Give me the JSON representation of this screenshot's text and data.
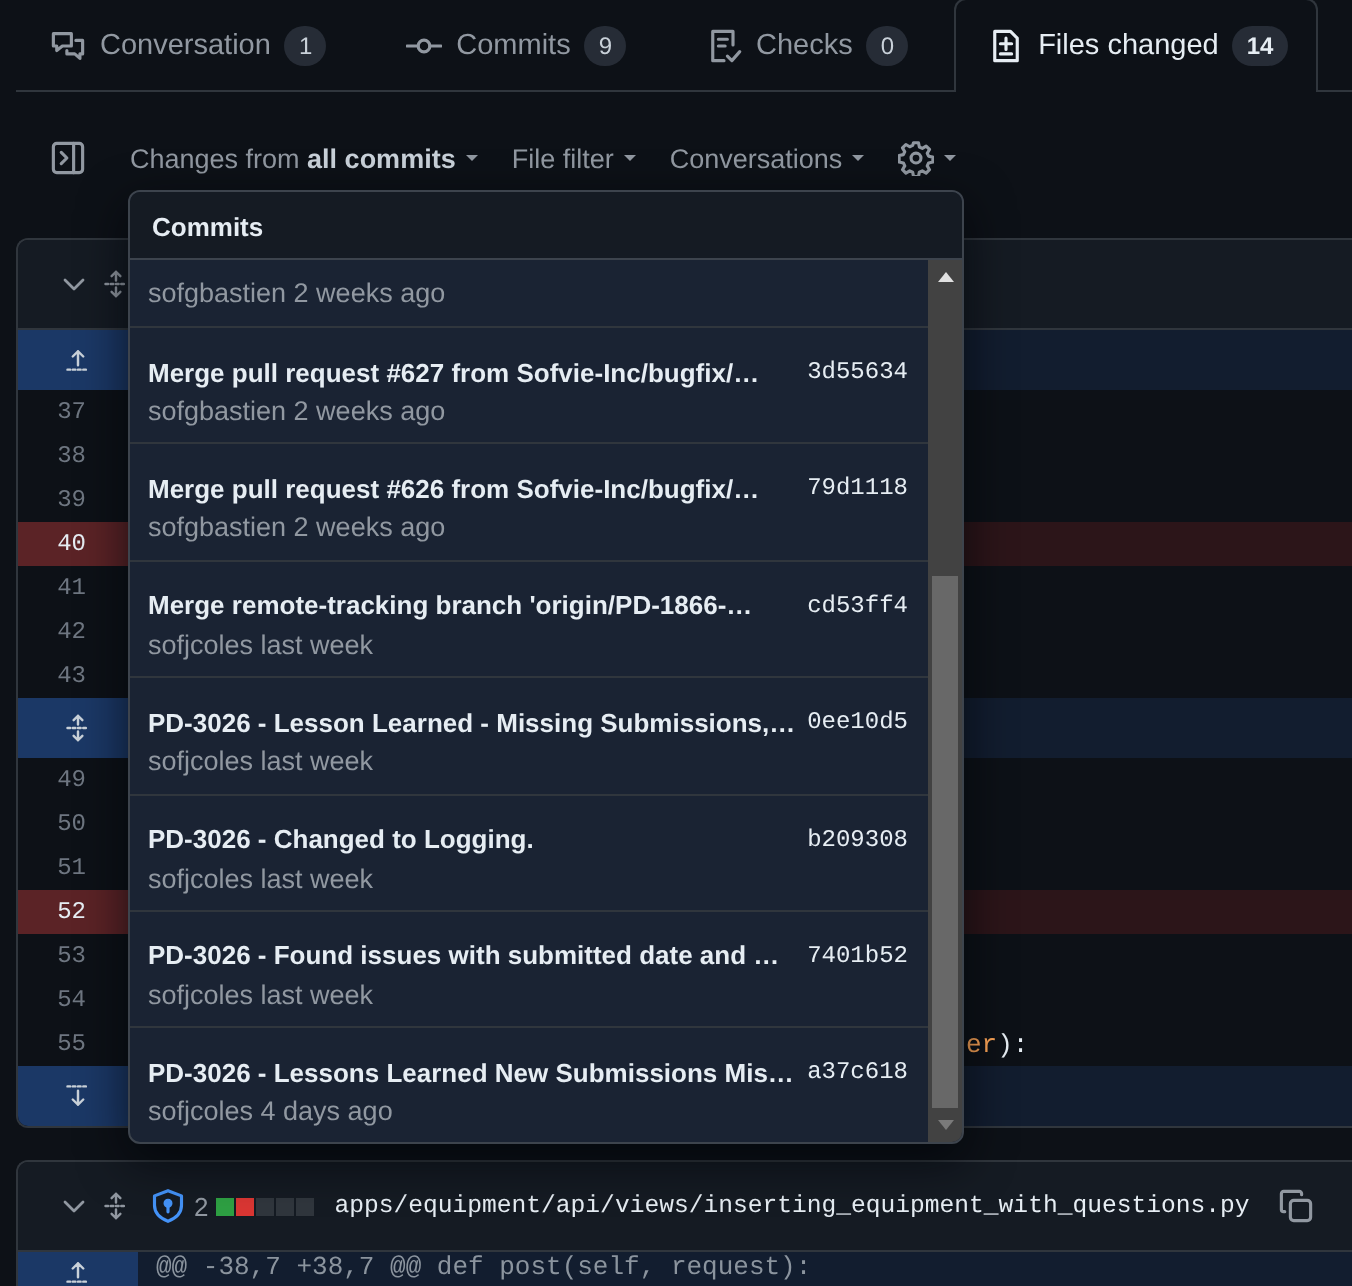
{
  "tabs": [
    {
      "label": "Conversation",
      "count": "1",
      "selected": false
    },
    {
      "label": "Commits",
      "count": "9",
      "selected": false
    },
    {
      "label": "Checks",
      "count": "0",
      "selected": false
    },
    {
      "label": "Files changed",
      "count": "14",
      "selected": true
    }
  ],
  "toolbar": {
    "changes": "Changes from **all commits**",
    "file_filter": "File filter",
    "conversations": "Conversations"
  },
  "diff_lines": [
    {
      "kind": "expand_up"
    },
    {
      "kind": "context",
      "number": "37"
    },
    {
      "kind": "context",
      "number": "38"
    },
    {
      "kind": "context",
      "number": "39"
    },
    {
      "kind": "deleted",
      "number": "40"
    },
    {
      "kind": "context",
      "number": "41"
    },
    {
      "kind": "context",
      "number": "42"
    },
    {
      "kind": "context",
      "number": "43"
    },
    {
      "kind": "expand_both"
    },
    {
      "kind": "context",
      "number": "49"
    },
    {
      "kind": "context",
      "number": "50"
    },
    {
      "kind": "context",
      "number": "51"
    },
    {
      "kind": "deleted",
      "number": "52"
    },
    {
      "kind": "context",
      "number": "53"
    },
    {
      "kind": "context",
      "number": "54"
    },
    {
      "kind": "context",
      "number": "55",
      "code": [
        {
          "text": "er",
          "kind": "name"
        },
        {
          "text": "):",
          "kind": "punct"
        }
      ]
    },
    {
      "kind": "expand_down"
    }
  ],
  "commits_menu": {
    "title": "Commits",
    "items": [
      {
        "meta": "sofgbastien 2 weeks ago"
      },
      {
        "title": "Merge pull request #627 from Sofvie-Inc/bugfix/…",
        "hash": "3d55634",
        "meta": "sofgbastien 2 weeks ago"
      },
      {
        "title": "Merge pull request #626 from Sofvie-Inc/bugfix/…",
        "hash": "79d1118",
        "meta": "sofgbastien 2 weeks ago"
      },
      {
        "title": "Merge remote-tracking branch 'origin/PD-1866-…",
        "hash": "cd53ff4",
        "meta": "sofjcoles last week"
      },
      {
        "title": "PD-3026 - Lesson Learned - Missing Submissions,…",
        "hash": "0ee10d5",
        "meta": "sofjcoles last week"
      },
      {
        "title": "PD-3026 - Changed to Logging.",
        "hash": "b209308",
        "meta": "sofjcoles last week"
      },
      {
        "title": "PD-3026 - Found issues with submitted date and …",
        "hash": "7401b52",
        "meta": "sofjcoles last week"
      },
      {
        "title": "PD-3026 - Lessons Learned New Submissions Mis…",
        "hash": "a37c618",
        "meta": "sofjcoles 4 days ago"
      }
    ]
  },
  "second_file": {
    "changes": "2",
    "diffstat": [
      {
        "color": "#2ea043"
      },
      {
        "color": "#da3633"
      },
      {
        "color": "#30363d"
      },
      {
        "color": "#30363d"
      },
      {
        "color": "#30363d"
      }
    ],
    "path": "apps/equipment/api/views/inserting_equipment_with_questions.py",
    "hunk": "@@ -38,7 +38,7 @@ def post(self, request):"
  }
}
